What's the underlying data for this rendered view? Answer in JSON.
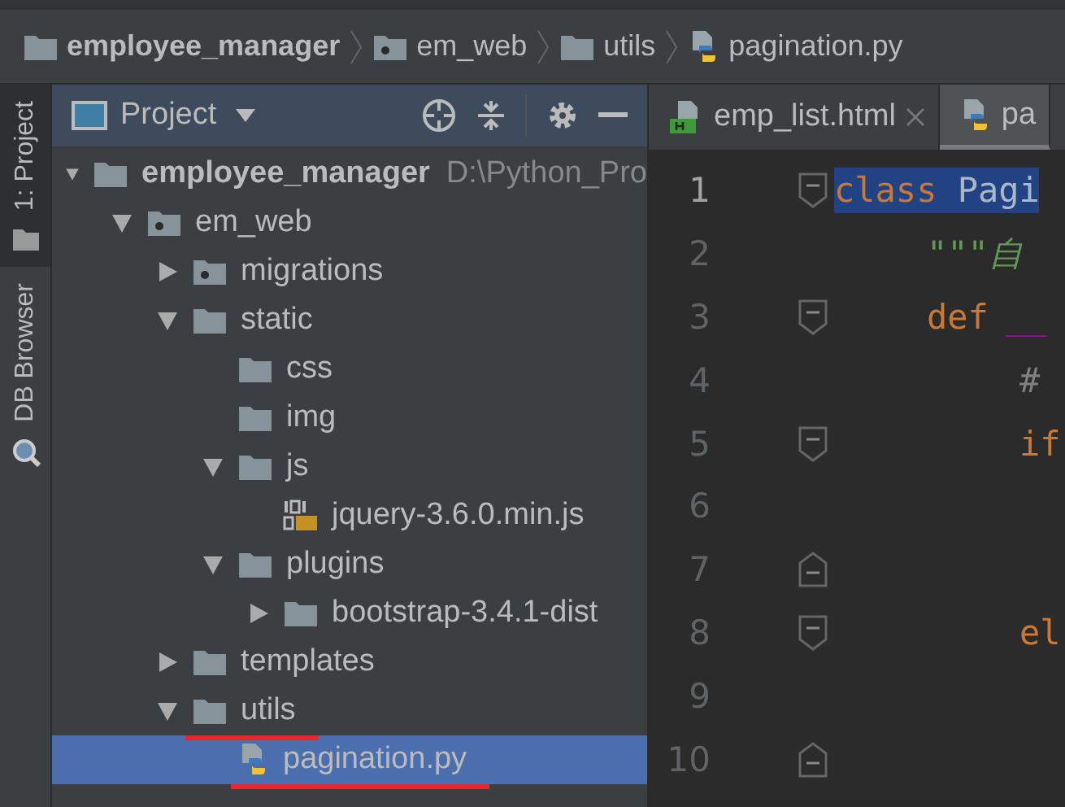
{
  "breadcrumb": [
    {
      "label": "employee_manager",
      "kind": "folder"
    },
    {
      "label": "em_web",
      "kind": "module"
    },
    {
      "label": "utils",
      "kind": "folder"
    },
    {
      "label": "pagination.py",
      "kind": "python"
    }
  ],
  "side_tabs": [
    {
      "label": "1: Project",
      "selected": true
    },
    {
      "label": "DB Browser",
      "selected": false
    }
  ],
  "project_panel": {
    "title": "Project"
  },
  "tree": [
    {
      "label": "employee_manager",
      "hint": "D:\\Python_Pro",
      "kind": "folder",
      "expanded": true,
      "selected": false,
      "children": [
        {
          "label": "em_web",
          "kind": "module",
          "expanded": true,
          "selected": false,
          "children": [
            {
              "label": "migrations",
              "kind": "module",
              "expanded": false,
              "selected": false
            },
            {
              "label": "static",
              "kind": "folder",
              "expanded": true,
              "selected": false,
              "children": [
                {
                  "label": "css",
                  "kind": "folder",
                  "selected": false
                },
                {
                  "label": "img",
                  "kind": "folder",
                  "selected": false
                },
                {
                  "label": "js",
                  "kind": "folder",
                  "expanded": true,
                  "selected": false,
                  "children": [
                    {
                      "label": "jquery-3.6.0.min.js",
                      "kind": "js",
                      "selected": false
                    }
                  ]
                },
                {
                  "label": "plugins",
                  "kind": "folder",
                  "expanded": true,
                  "selected": false,
                  "children": [
                    {
                      "label": "bootstrap-3.4.1-dist",
                      "kind": "folder",
                      "expanded": false,
                      "selected": false
                    }
                  ]
                }
              ]
            },
            {
              "label": "templates",
              "kind": "folder",
              "expanded": false,
              "selected": false
            },
            {
              "label": "utils",
              "kind": "folder",
              "expanded": true,
              "selected": false,
              "underlined": true,
              "children": [
                {
                  "label": "pagination.py",
                  "kind": "python",
                  "selected": true,
                  "underlined": true
                }
              ]
            }
          ]
        }
      ]
    }
  ],
  "editor_tabs": [
    {
      "label": "emp_list.html",
      "kind": "html",
      "selected": false,
      "closable": true
    },
    {
      "label": "pa",
      "kind": "python",
      "selected": true
    }
  ],
  "code_lines": [
    {
      "number": "1",
      "kind": "fold_start",
      "selected": true,
      "tokens": [
        {
          "text": "class",
          "kind": "keyword"
        },
        {
          "text": " Pagi",
          "kind": "plain"
        }
      ],
      "children": [
        {
          "number": "2",
          "kind": "plain",
          "selected": false,
          "tokens": [
            {
              "text": "\"\"\"自",
              "kind": "docstring"
            }
          ]
        },
        {
          "number": "3",
          "kind": "fold_start",
          "selected": false,
          "tokens": [
            {
              "text": "def",
              "kind": "keyword"
            },
            {
              "text": "__",
              "kind": "dunder"
            }
          ],
          "children": [
            {
              "number": "4",
              "kind": "plain",
              "selected": false,
              "tokens": [
                {
                  "text": "#",
                  "kind": "comment"
                }
              ]
            },
            {
              "number": "5",
              "kind": "fold_start",
              "selected": false,
              "tokens": [
                {
                  "text": "if",
                  "kind": "keyword"
                }
              ]
            },
            {
              "number": "6",
              "kind": "plain",
              "selected": false
            },
            {
              "number": "7",
              "kind": "fold_end",
              "selected": false
            },
            {
              "number": "8",
              "kind": "fold_start",
              "selected": false,
              "tokens": [
                {
                  "text": "el",
                  "kind": "keyword"
                }
              ]
            },
            {
              "number": "9",
              "kind": "plain",
              "selected": false
            },
            {
              "number": "10",
              "kind": "fold_end",
              "selected": false
            }
          ]
        }
      ]
    }
  ]
}
